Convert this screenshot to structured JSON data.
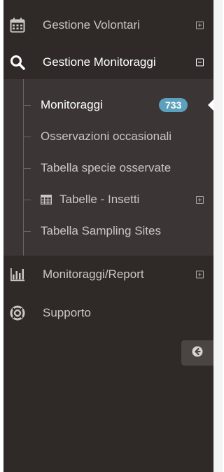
{
  "menu": {
    "gestione_volontari": {
      "label": "Gestione Volontari",
      "icon": "calendar-icon"
    },
    "gestione_monitoraggi": {
      "label": "Gestione Monitoraggi",
      "icon": "search-icon"
    },
    "monitoraggi_report": {
      "label": "Monitoraggi/Report",
      "icon": "bar-chart-icon"
    },
    "supporto": {
      "label": "Supporto",
      "icon": "lifebuoy-icon"
    }
  },
  "submenu": {
    "items": [
      {
        "label": "Monitoraggi",
        "badge": "733"
      },
      {
        "label": "Osservazioni occasionali"
      },
      {
        "label": "Tabella specie osservate"
      },
      {
        "label": "Tabelle - Insetti",
        "icon": "table-icon"
      },
      {
        "label": "Tabella Sampling Sites"
      }
    ]
  },
  "colors": {
    "sidebar_bg": "#2f2a28",
    "submenu_bg": "#3b3635",
    "badge_bg": "#5ba0bd",
    "text": "#c9c6c4",
    "text_active": "#ffffff"
  },
  "collapse_button": {
    "icon": "arrow-circle-left-icon"
  }
}
